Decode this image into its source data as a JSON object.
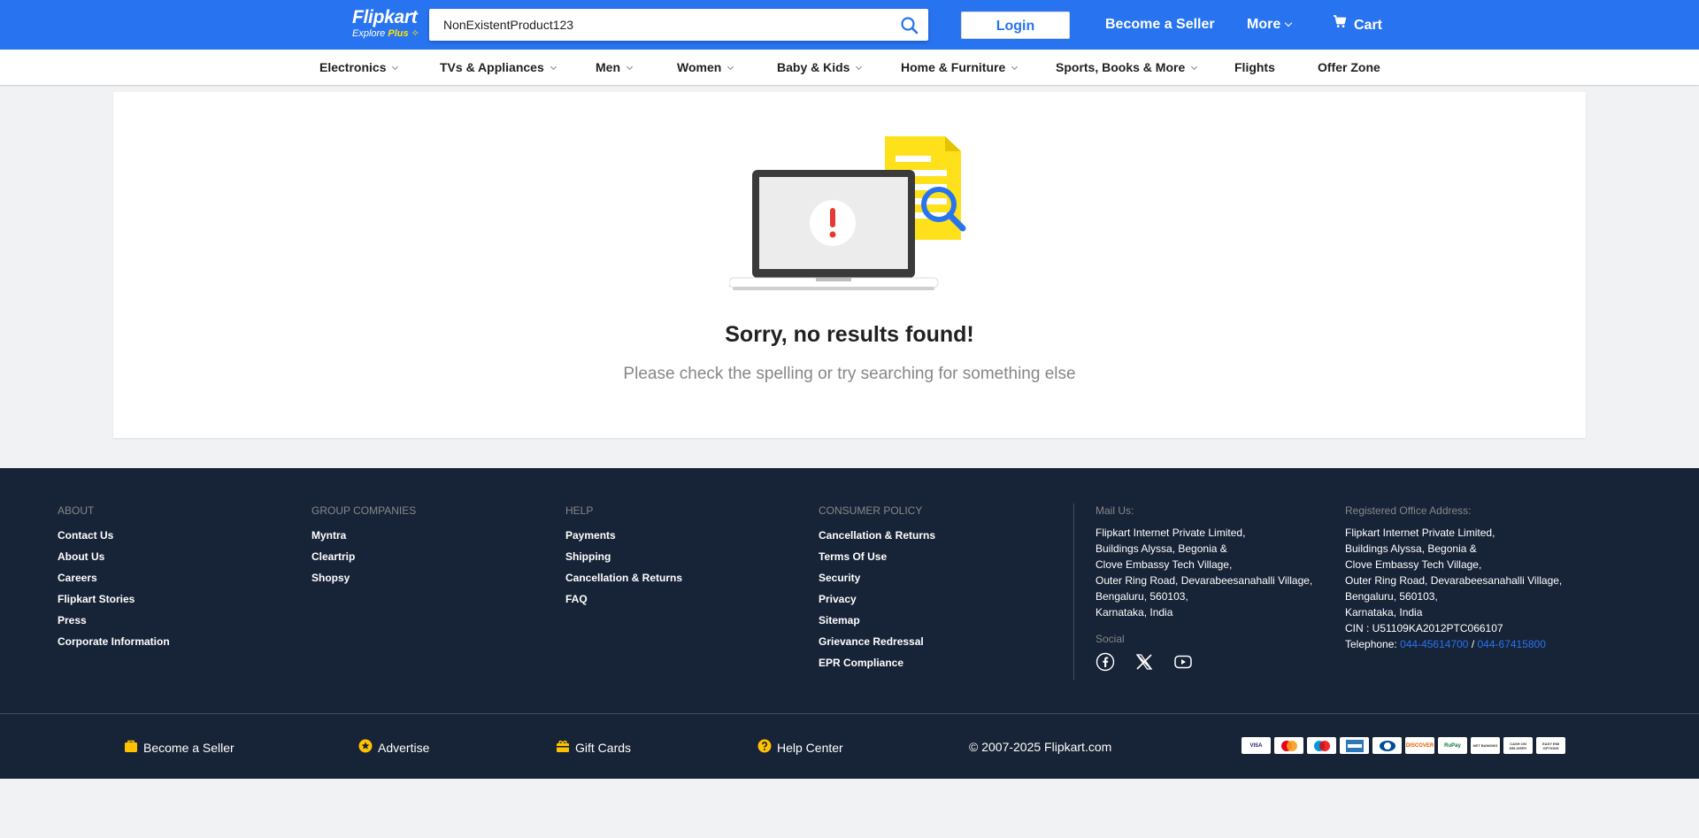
{
  "header": {
    "logo_text": "Flipkart",
    "logo_sub": "Explore",
    "logo_plus": "Plus",
    "search_value": "NonExistentProduct123",
    "login_label": "Login",
    "seller_label": "Become a Seller",
    "more_label": "More",
    "cart_label": "Cart"
  },
  "categories": [
    {
      "label": "Electronics",
      "has_menu": true
    },
    {
      "label": "TVs & Appliances",
      "has_menu": true
    },
    {
      "label": "Men",
      "has_menu": true
    },
    {
      "label": "Women",
      "has_menu": true
    },
    {
      "label": "Baby & Kids",
      "has_menu": true
    },
    {
      "label": "Home & Furniture",
      "has_menu": true
    },
    {
      "label": "Sports, Books & More",
      "has_menu": true
    },
    {
      "label": "Flights",
      "has_menu": false
    },
    {
      "label": "Offer Zone",
      "has_menu": false
    }
  ],
  "results": {
    "title": "Sorry, no results found!",
    "subtitle": "Please check the spelling or try searching for something else"
  },
  "footer": {
    "about": {
      "heading": "ABOUT",
      "links": [
        "Contact Us",
        "About Us",
        "Careers",
        "Flipkart Stories",
        "Press",
        "Corporate Information"
      ]
    },
    "group": {
      "heading": "GROUP COMPANIES",
      "links": [
        "Myntra",
        "Cleartrip",
        "Shopsy"
      ]
    },
    "help": {
      "heading": "HELP",
      "links": [
        "Payments",
        "Shipping",
        "Cancellation & Returns",
        "FAQ"
      ]
    },
    "policy": {
      "heading": "CONSUMER POLICY",
      "links": [
        "Cancellation & Returns",
        "Terms Of Use",
        "Security",
        "Privacy",
        "Sitemap",
        "Grievance Redressal",
        "EPR Compliance"
      ]
    },
    "mail": {
      "heading": "Mail Us:",
      "lines": [
        "Flipkart Internet Private Limited,",
        "Buildings Alyssa, Begonia &",
        "Clove Embassy Tech Village,",
        "Outer Ring Road, Devarabeesanahalli Village,",
        "Bengaluru, 560103,",
        "Karnataka, India"
      ]
    },
    "social_heading": "Social",
    "social_icons": [
      "facebook-icon",
      "x-icon",
      "youtube-icon"
    ],
    "office": {
      "heading": "Registered Office Address:",
      "lines": [
        "Flipkart Internet Private Limited,",
        "Buildings Alyssa, Begonia &",
        "Clove Embassy Tech Village,",
        "Outer Ring Road, Devarabeesanahalli Village,",
        "Bengaluru, 560103,",
        "Karnataka, India",
        "CIN : U51109KA2012PTC066107"
      ],
      "telephone_label": "Telephone: ",
      "phone1": "044-45614700",
      "phone_sep": " / ",
      "phone2": "044-67415800"
    },
    "bottom": {
      "seller": "Become a Seller",
      "advertise": "Advertise",
      "gift_cards": "Gift Cards",
      "help_center": "Help Center",
      "copyright": "© 2007-2025 Flipkart.com"
    },
    "payment_methods": [
      "VISA",
      "MC",
      "Maestro",
      "AMEX",
      "Diners",
      "DISCOVER",
      "RuPay",
      "NET BANKING",
      "CASH ON DELIVERY",
      "EASY EMI OPTIONS"
    ]
  },
  "colors": {
    "brand_blue": "#2874f0",
    "logo_yellow": "#ffe500",
    "footer_bg": "#172337",
    "error_red": "#e53935",
    "gift_yellow": "#ffc200"
  }
}
